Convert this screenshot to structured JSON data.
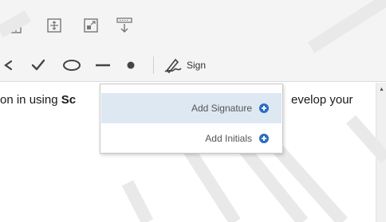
{
  "toolbar": {
    "icons": [
      "page-fit-height-icon",
      "fit-page-icon",
      "fit-width-icon",
      "reading-mode-icon"
    ],
    "markup_tools": [
      "cross-mark-icon",
      "check-mark-icon",
      "ellipse-icon",
      "line-icon",
      "dot-icon"
    ],
    "sign_label": "Sign"
  },
  "document": {
    "text_left": "on in using ",
    "text_bold": "Sc",
    "text_right": "evelop your"
  },
  "sign_menu": {
    "items": [
      {
        "label": "Add Signature",
        "icon": "add-circle-icon",
        "highlighted": true
      },
      {
        "label": "Add Initials",
        "icon": "add-circle-icon",
        "highlighted": false
      }
    ]
  },
  "colors": {
    "toolbar_bg": "#f4f4f4",
    "accent": "#2a6ec2",
    "highlight": "#dde8f3"
  }
}
